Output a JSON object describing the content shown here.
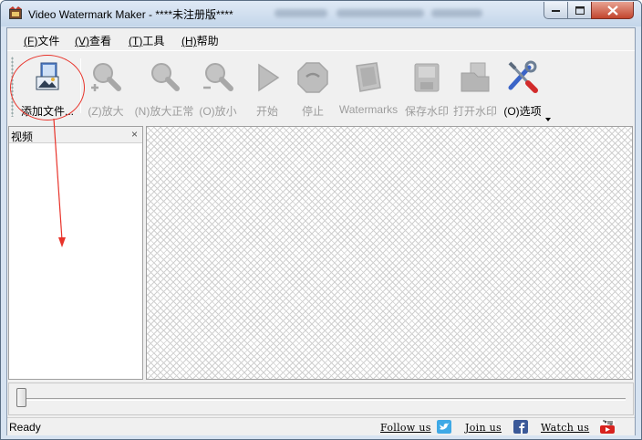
{
  "window": {
    "title": "Video Watermark Maker - ****未注册版****",
    "buttons": [
      "minimize",
      "maximize",
      "close"
    ]
  },
  "menu": [
    {
      "accel": "(F)",
      "label": "文件"
    },
    {
      "accel": "(V)",
      "label": "查看"
    },
    {
      "accel": "(T)",
      "label": "工具"
    },
    {
      "accel": "(H)",
      "label": "帮助"
    }
  ],
  "toolbar": {
    "add_file": {
      "label": "添加文件...",
      "icon": "add-file-icon",
      "enabled": true
    },
    "zoom_in": {
      "label": "(Z)放大",
      "icon": "zoom-in-icon",
      "enabled": false
    },
    "zoom_normal": {
      "label": "(N)放大正常",
      "icon": "zoom-normal-icon",
      "enabled": false
    },
    "zoom_out": {
      "label": "(O)放小",
      "icon": "zoom-out-icon",
      "enabled": false
    },
    "start": {
      "label": "开始",
      "icon": "play-icon",
      "enabled": false
    },
    "stop": {
      "label": "停止",
      "icon": "stop-icon",
      "enabled": false
    },
    "watermarks": {
      "label": "Watermarks",
      "icon": "watermarks-icon",
      "enabled": false
    },
    "save_watermark": {
      "label": "保存水印",
      "icon": "save-watermark-icon",
      "enabled": false
    },
    "open_watermark": {
      "label": "打开水印",
      "icon": "open-watermark-icon",
      "enabled": false
    },
    "options": {
      "label": "(O)选项",
      "icon": "options-tools-icon",
      "enabled": true
    }
  },
  "panel": {
    "title": "视频",
    "close_glyph": "×"
  },
  "seek": {
    "position": 0
  },
  "status": {
    "text": "Ready",
    "follow_us": "Follow us",
    "join_us": "Join us",
    "watch_us": "Watch us"
  },
  "colors": {
    "annotation": "#e8332a",
    "twitter": "#3fa9e6",
    "facebook": "#3b5998",
    "youtube": "#d8231f"
  }
}
